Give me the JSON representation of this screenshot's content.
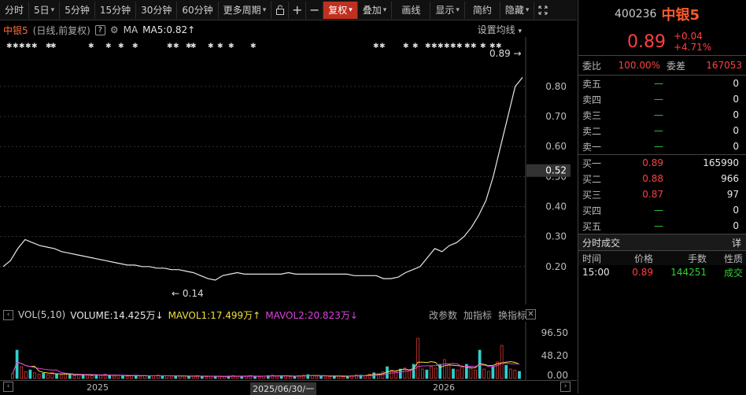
{
  "toolbar": {
    "items": [
      "分时",
      "5日",
      "5分钟",
      "15分钟",
      "30分钟",
      "60分钟",
      "更多周期"
    ],
    "lock_icon": "lock-icon",
    "plus_icon": "plus-icon",
    "minus_icon": "minus-icon",
    "fuquan": "复权",
    "overlay": "叠加",
    "draw": "画线",
    "display": "显示",
    "simple": "简约",
    "hide": "隐藏",
    "fullscreen_icon": "fullscreen-icon"
  },
  "chart": {
    "name": "中银5",
    "subtitle": "(日线,前复权)",
    "help": "?",
    "ma_label": "MA",
    "ma5": "MA5:0.82",
    "ma5_arrow": "↑",
    "setting": "设置均线"
  },
  "chart_data": {
    "type": "line",
    "series": [
      {
        "values": [
          0.2,
          0.22,
          0.26,
          0.29,
          0.28,
          0.27,
          0.265,
          0.26,
          0.25,
          0.245,
          0.24,
          0.235,
          0.23,
          0.225,
          0.22,
          0.215,
          0.21,
          0.205,
          0.205,
          0.2,
          0.2,
          0.195,
          0.195,
          0.19,
          0.19,
          0.185,
          0.18,
          0.17,
          0.16,
          0.155,
          0.17,
          0.175,
          0.18,
          0.175,
          0.175,
          0.175,
          0.175,
          0.175,
          0.175,
          0.18,
          0.175,
          0.175,
          0.175,
          0.175,
          0.175,
          0.175,
          0.175,
          0.175,
          0.17,
          0.17,
          0.17,
          0.17,
          0.16,
          0.16,
          0.165,
          0.18,
          0.19,
          0.2,
          0.23,
          0.26,
          0.25,
          0.27,
          0.28,
          0.3,
          0.33,
          0.37,
          0.42,
          0.5,
          0.6,
          0.7,
          0.8,
          0.83
        ]
      }
    ],
    "y_ticks": [
      "0.80",
      "0.70",
      "0.60",
      "0.50",
      "0.40",
      "0.30",
      "0.20"
    ],
    "ylim": [
      0.1,
      0.86
    ],
    "current_tag": "0.52",
    "max_label": "0.89",
    "min_label": "0.14",
    "volume": {
      "y_ticks": [
        "96.50",
        "48.20",
        "0.00"
      ],
      "ylim": [
        0,
        110
      ],
      "values": [
        10,
        60,
        25,
        14,
        18,
        12,
        9,
        11,
        8,
        13,
        9,
        7,
        10,
        8,
        6,
        9,
        8,
        7,
        6,
        8,
        7,
        9,
        6,
        5,
        7,
        6,
        5,
        6,
        7,
        5,
        6,
        5,
        6,
        7,
        5,
        6,
        5,
        5,
        6,
        5,
        4,
        5,
        6,
        5,
        4,
        5,
        4,
        5,
        4,
        5,
        6,
        5,
        4,
        5,
        6,
        5,
        4,
        5,
        6,
        7,
        5,
        6,
        5,
        4,
        5,
        6,
        7,
        8,
        6,
        5,
        6,
        5,
        4,
        6,
        5,
        4,
        5,
        6,
        8,
        7,
        6,
        9,
        12,
        10,
        14,
        25,
        18,
        15,
        20,
        22,
        16,
        30,
        85,
        20,
        18,
        25,
        22,
        30,
        40,
        28,
        20,
        18,
        25,
        30,
        22,
        18,
        60,
        20,
        15,
        25,
        35,
        70,
        28,
        20,
        18,
        15
      ]
    },
    "x_labels": [
      "2025",
      "2026"
    ],
    "x_date_tag": "2025/06/30/一"
  },
  "volume_header": {
    "title": "VOL(5,10)",
    "volume": "VOLUME:14.425万",
    "volume_arrow": "↓",
    "mavol1": "MAVOL1:17.499万",
    "mavol1_arrow": "↑",
    "mavol2": "MAVOL2:20.823万",
    "mavol2_arrow": "↓",
    "tools": [
      "改参数",
      "加指标",
      "换指标"
    ]
  },
  "quote": {
    "code": "400236",
    "name": "中银5",
    "price": "0.89",
    "change": "+0.04",
    "change_pct": "+4.71%",
    "weibi_label": "委比",
    "weibi": "100.00%",
    "weicha_label": "委差",
    "weicha": "167053",
    "asks": [
      {
        "label": "卖五",
        "price": "—",
        "vol": "0"
      },
      {
        "label": "卖四",
        "price": "—",
        "vol": "0"
      },
      {
        "label": "卖三",
        "price": "—",
        "vol": "0"
      },
      {
        "label": "卖二",
        "price": "—",
        "vol": "0"
      },
      {
        "label": "卖一",
        "price": "—",
        "vol": "0"
      }
    ],
    "bids": [
      {
        "label": "买一",
        "price": "0.89",
        "vol": "165990"
      },
      {
        "label": "买二",
        "price": "0.88",
        "vol": "966"
      },
      {
        "label": "买三",
        "price": "0.87",
        "vol": "97"
      },
      {
        "label": "买四",
        "price": "—",
        "vol": "0"
      },
      {
        "label": "买五",
        "price": "—",
        "vol": "0"
      }
    ],
    "ticks_title": "分时成交",
    "ticks_more": "详",
    "tick_headers": [
      "时间",
      "价格",
      "手数",
      "性质"
    ],
    "ticks": [
      {
        "time": "15:00",
        "price": "0.89",
        "vol": "144251",
        "type": "成交"
      }
    ]
  },
  "colors": {
    "up": "#ff4040",
    "down": "#30d030",
    "price_line": "#e8e8e8",
    "mavol1": "#f0e040",
    "mavol2": "#e040e0",
    "accent": "#c03020"
  }
}
